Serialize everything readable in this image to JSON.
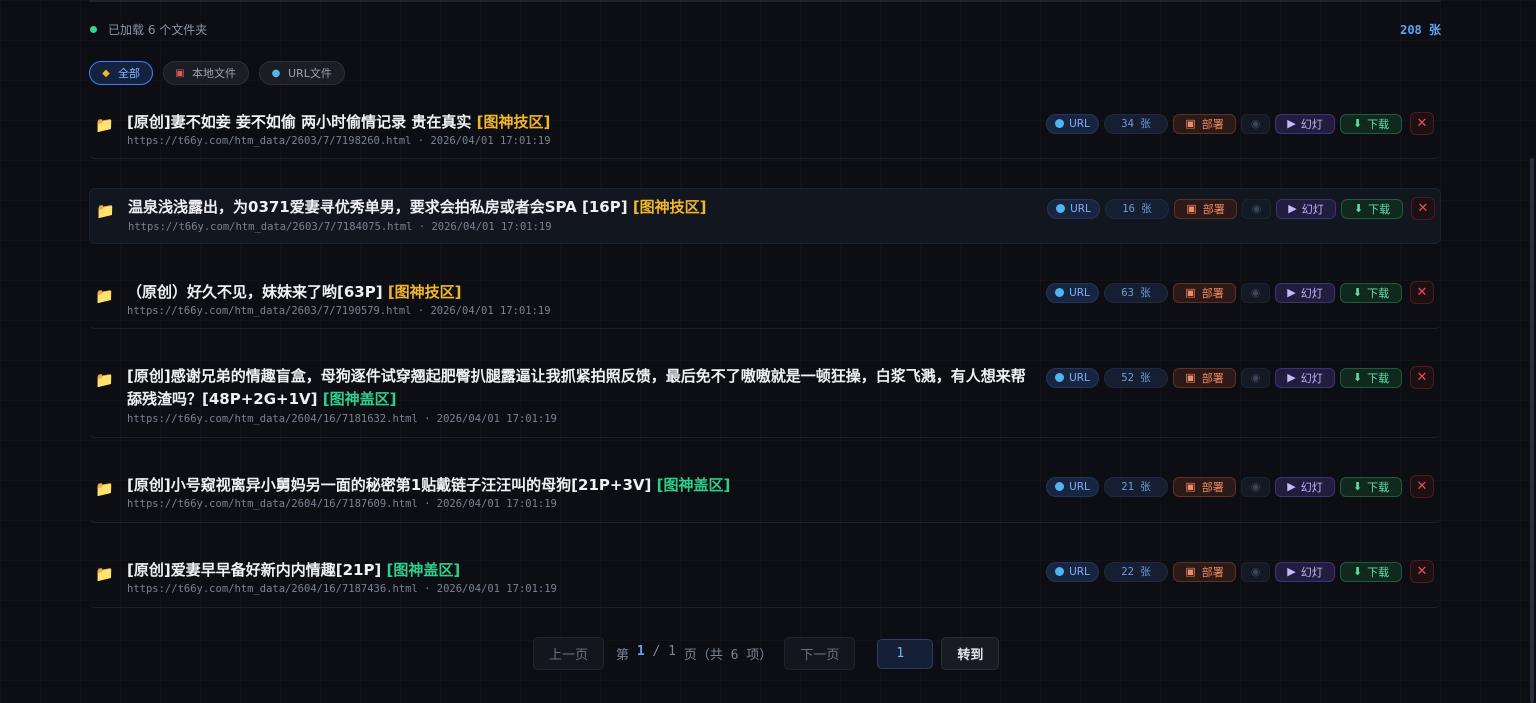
{
  "status": {
    "loaded_text": "已加载 6 个文件夹",
    "total_count": "208 张"
  },
  "filters": [
    {
      "label": "全部",
      "icon": "tag-icon",
      "active": true
    },
    {
      "label": "本地文件",
      "icon": "disk-icon",
      "active": false
    },
    {
      "label": "URL文件",
      "icon": "globe-icon",
      "active": false
    }
  ],
  "actions": {
    "url": "URL",
    "deploy": "部署",
    "slideshow": "幻灯",
    "download": "下载",
    "close": "✕"
  },
  "items": [
    {
      "title": "[原创]妻不如妾 妾不如偷 两小时偷情记录 贵在真实",
      "tag": "[图神技区]",
      "tag_color": "#f2b629",
      "url": "https://t66y.com/htm_data/2603/7/7198260.html",
      "time": "2026/04/01 17:01:19",
      "count": "34 张"
    },
    {
      "title": "温泉浅浅露出，为0371爱妻寻优秀单男，要求会拍私房或者会SPA [16P]",
      "tag": "[图神技区]",
      "tag_color": "#f2b629",
      "url": "https://t66y.com/htm_data/2603/7/7184075.html",
      "time": "2026/04/01 17:01:19",
      "count": "16 张"
    },
    {
      "title": "（原创）好久不见，妹妹来了哟[63P]",
      "tag": "[图神技区]",
      "tag_color": "#f2b629",
      "url": "https://t66y.com/htm_data/2603/7/7190579.html",
      "time": "2026/04/01 17:01:19",
      "count": "63 张"
    },
    {
      "title": "[原创]感谢兄弟的情趣盲盒，母狗逐件试穿翘起肥臀扒腿露逼让我抓紧拍照反馈，最后免不了嗷嗷就是一顿狂操，白浆飞溅，有人想来帮舔残渣吗？[48P+2G+1V]",
      "tag": "[图神盖区]",
      "tag_color": "#2ecf8c",
      "url": "https://t66y.com/htm_data/2604/16/7181632.html",
      "time": "2026/04/01 17:01:19",
      "count": "52 张"
    },
    {
      "title": "[原创]小号窥视离异小舅妈另一面的秘密第1贴戴链子汪汪叫的母狗[21P+3V]",
      "tag": "[图神盖区]",
      "tag_color": "#2ecf8c",
      "url": "https://t66y.com/htm_data/2604/16/7187609.html",
      "time": "2026/04/01 17:01:19",
      "count": "21 张"
    },
    {
      "title": "[原创]爱妻早早备好新内内情趣[21P]",
      "tag": "[图神盖区]",
      "tag_color": "#2ecf8c",
      "url": "https://t66y.com/htm_data/2604/16/7187436.html",
      "time": "2026/04/01 17:01:19",
      "count": "22 张"
    }
  ],
  "pagination": {
    "prev": "上一页",
    "label_page": "第",
    "current": "1",
    "sep": "/",
    "total_pages": "1",
    "label_suffix": "页（共 6 项）",
    "next": "下一页",
    "jump_value": "1",
    "go": "转到"
  }
}
